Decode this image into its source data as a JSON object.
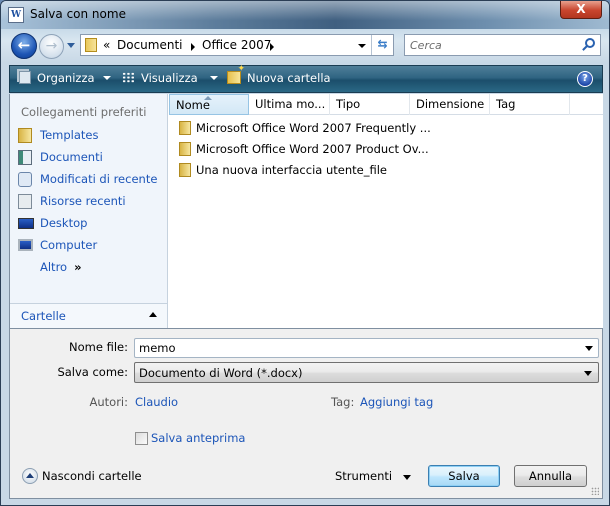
{
  "window": {
    "title": "Salva con nome",
    "app_icon": "word-document-icon",
    "close_label": "X"
  },
  "navigation": {
    "back_icon": "back-arrow-icon",
    "forward_icon": "forward-arrow-icon",
    "overflow_glyph": "«",
    "breadcrumb": [
      "Documenti",
      "Office 2007"
    ],
    "refresh_glyph": "⇆"
  },
  "search": {
    "placeholder": "Cerca",
    "value": ""
  },
  "toolbar": {
    "organize_label": "Organizza",
    "views_label": "Visualizza",
    "new_folder_label": "Nuova cartella",
    "help_glyph": "?"
  },
  "left_pane": {
    "heading": "Collegamenti preferiti",
    "items": [
      {
        "label": "Templates",
        "icon": "folder-icon"
      },
      {
        "label": "Documenti",
        "icon": "documents-icon"
      },
      {
        "label": "Modificati di recente",
        "icon": "recently-changed-icon"
      },
      {
        "label": "Risorse recenti",
        "icon": "recent-places-icon"
      },
      {
        "label": "Desktop",
        "icon": "desktop-icon"
      },
      {
        "label": "Computer",
        "icon": "computer-icon"
      }
    ],
    "more_label": "Altro",
    "more_glyph": "»",
    "folders_label": "Cartelle"
  },
  "file_list": {
    "columns": [
      "Nome",
      "Ultima mo...",
      "Tipo",
      "Dimensione",
      "Tag"
    ],
    "sorted_column": "Nome",
    "rows": [
      {
        "name": "Microsoft Office Word 2007 Frequently ...",
        "type": "folder"
      },
      {
        "name": "Microsoft Office Word 2007 Product Ov...",
        "type": "folder"
      },
      {
        "name": "Una nuova interfaccia utente_file",
        "type": "folder"
      }
    ]
  },
  "form": {
    "filename_label": "Nome file:",
    "filename_value": "memo",
    "savetype_label": "Salva come:",
    "savetype_value": "Documento di Word (*.docx)",
    "authors_label": "Autori:",
    "authors_value": "Claudio",
    "tags_label": "Tag:",
    "tags_value": "Aggiungi tag",
    "thumbnail_label": "Salva anteprima",
    "thumbnail_checked": false
  },
  "footer": {
    "hide_folders_label": "Nascondi cartelle",
    "tools_label": "Strumenti",
    "save_label": "Salva",
    "cancel_label": "Annulla"
  }
}
